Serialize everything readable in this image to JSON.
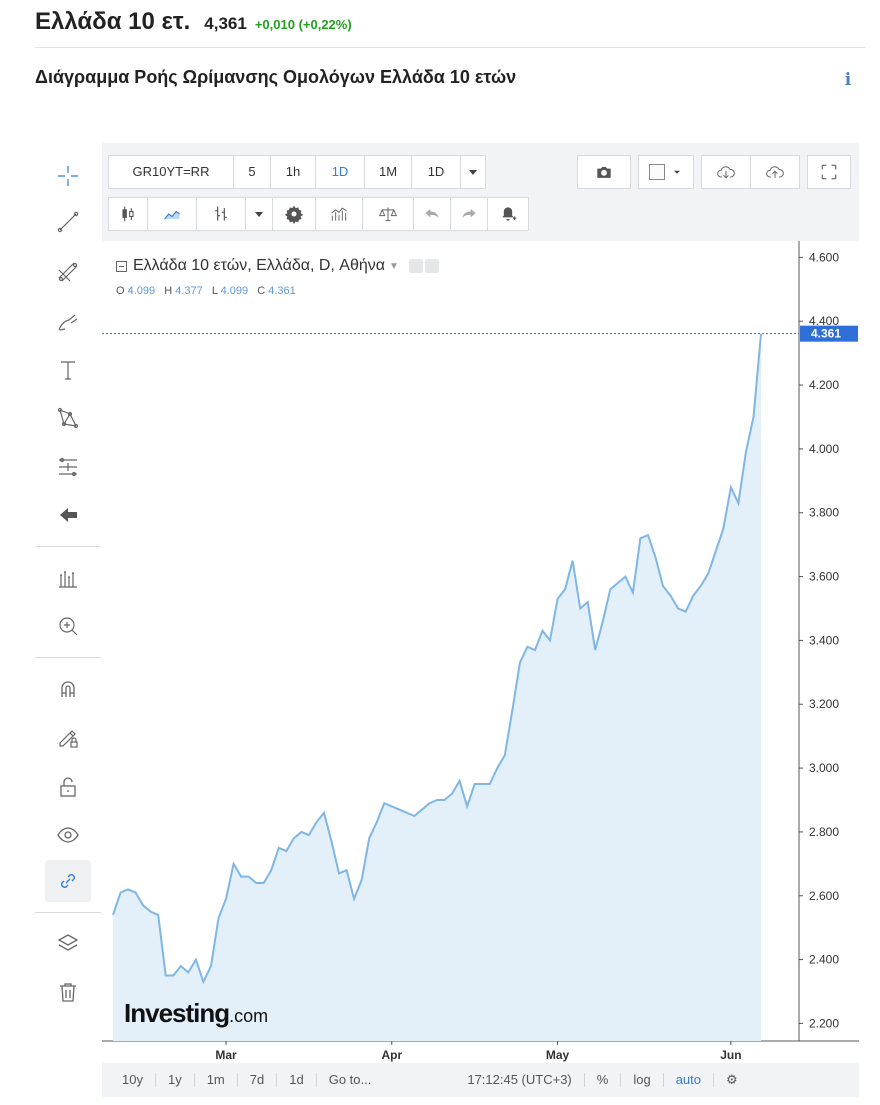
{
  "header": {
    "name": "Ελλάδα 10 ετ.",
    "price": "4,361",
    "change": "+0,010 (+0,22%)"
  },
  "chart_title": "Διάγραμμα Ροής Ωρίμανσης Ομολόγων Ελλάδα 10 ετών",
  "info_label": "i",
  "toolbar": {
    "symbol": "GR10YT=RR",
    "intervals": [
      "5",
      "1h",
      "1D",
      "1M",
      "1D"
    ],
    "active_interval": "1D"
  },
  "legend": {
    "title": "Ελλάδα 10 ετών, Ελλάδα, D, Αθήνα"
  },
  "ohlc": {
    "o_label": "O",
    "o": "4.099",
    "h_label": "H",
    "h": "4.377",
    "l_label": "L",
    "l": "4.099",
    "c_label": "C",
    "c": "4.361"
  },
  "logo": {
    "main": "Investing",
    "suffix": ".com"
  },
  "bottom": {
    "ranges": [
      "10y",
      "1y",
      "1m",
      "7d",
      "1d"
    ],
    "goto": "Go to...",
    "time": "17:12:45 (UTC+3)",
    "percent": "%",
    "log": "log",
    "auto": "auto"
  },
  "colors": {
    "line": "#7fb6e6",
    "area": "#e3f0fa",
    "accent": "#2f7ed8",
    "positive": "#21a121",
    "price_tag": "#2f6fd8"
  },
  "chart_data": {
    "type": "area",
    "y_ticks": [
      "4.600",
      "4.400",
      "4.200",
      "4.000",
      "3.800",
      "3.600",
      "3.400",
      "3.200",
      "3.000",
      "2.800",
      "2.600",
      "2.400",
      "2.200"
    ],
    "ylim": [
      2.17,
      4.62
    ],
    "x_ticks": [
      {
        "label": "Mar",
        "index": 15
      },
      {
        "label": "Apr",
        "index": 37
      },
      {
        "label": "May",
        "index": 59
      },
      {
        "label": "Jun",
        "index": 82
      }
    ],
    "last_value_label": "4.361",
    "last_value": 4.361,
    "values": [
      2.54,
      2.61,
      2.62,
      2.61,
      2.57,
      2.55,
      2.54,
      2.35,
      2.35,
      2.38,
      2.36,
      2.4,
      2.33,
      2.38,
      2.53,
      2.59,
      2.7,
      2.66,
      2.66,
      2.64,
      2.64,
      2.68,
      2.75,
      2.74,
      2.78,
      2.8,
      2.79,
      2.83,
      2.86,
      2.77,
      2.67,
      2.68,
      2.59,
      2.65,
      2.78,
      2.83,
      2.89,
      2.88,
      2.87,
      2.86,
      2.85,
      2.87,
      2.89,
      2.9,
      2.9,
      2.92,
      2.96,
      2.88,
      2.95,
      2.95,
      2.95,
      3.0,
      3.04,
      3.18,
      3.33,
      3.38,
      3.37,
      3.43,
      3.4,
      3.53,
      3.56,
      3.65,
      3.5,
      3.52,
      3.37,
      3.46,
      3.56,
      3.58,
      3.6,
      3.55,
      3.72,
      3.73,
      3.66,
      3.57,
      3.54,
      3.5,
      3.49,
      3.54,
      3.57,
      3.61,
      3.68,
      3.75,
      3.88,
      3.83,
      3.99,
      4.1,
      4.36
    ]
  }
}
